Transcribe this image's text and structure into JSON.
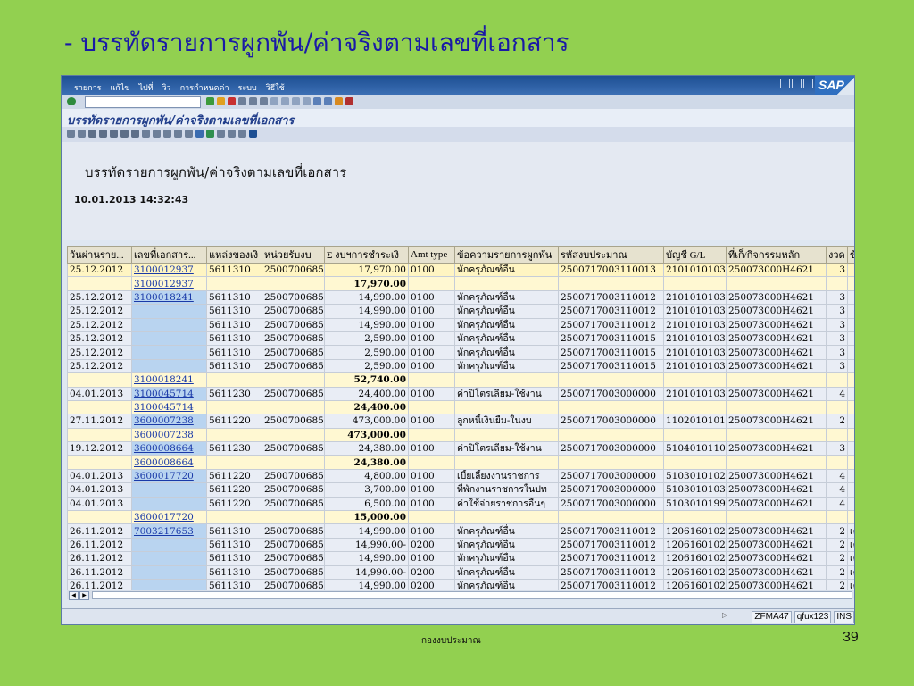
{
  "slide": {
    "title": "- บรรทัดรายการผูกพัน/ค่าจริงตามเลขที่เอกสาร",
    "footer": "กองงบประมาณ",
    "page_number": "39"
  },
  "sap": {
    "menu": [
      "รายการ",
      "แก้ไข",
      "ไปที่",
      "วิว",
      "การกำหนดค่า",
      "ระบบ",
      "วิธีใช้"
    ],
    "logo": "SAP",
    "screen_title": "บรรทัดรายการผูกพัน/ค่าจริงตามเลขที่เอกสาร",
    "report_title": "บรรทัดรายการผูกพัน/ค่าจริงตามเลขที่เอกสาร",
    "report_datetime": "10.01.2013 14:32:43",
    "columns": [
      "วันผ่านราย...",
      "เลขที่เอกสาร...",
      "แหล่งของเงิ",
      "หน่วยรับงบ",
      "Σ งบฯการชำระเงิ",
      "Amt type",
      "ข้อความรายการผูกพัน",
      "รหัสงบประมาณ",
      "บัญชี G/L",
      "ที่เก็/กิจกรรมหลัก",
      "งวด",
      "ข้อค"
    ],
    "rows": [
      {
        "type": "data",
        "first": true,
        "date": "25.12.2012",
        "doc": "3100012937",
        "fund": "5611310",
        "unit": "2500700685",
        "amt": "17,970.00",
        "amttype": "0100",
        "text": "หักครุภัณฑ์อื่น",
        "budget": "2500717003110013",
        "gl": "2101010103",
        "act": "250073000H4621",
        "per": "3",
        "x": ""
      },
      {
        "type": "sub",
        "doc": "3100012937",
        "amt": "17,970.00"
      },
      {
        "type": "data",
        "date": "25.12.2012",
        "doc": "3100018241",
        "fund": "5611310",
        "unit": "2500700685",
        "amt": "14,990.00",
        "amttype": "0100",
        "text": "หักครุภัณฑ์อื่น",
        "budget": "2500717003110012",
        "gl": "2101010103",
        "act": "250073000H4621",
        "per": "3",
        "x": ""
      },
      {
        "type": "data",
        "date": "25.12.2012",
        "doc": "",
        "fund": "5611310",
        "unit": "2500700685",
        "amt": "14,990.00",
        "amttype": "0100",
        "text": "หักครุภัณฑ์อื่น",
        "budget": "2500717003110012",
        "gl": "2101010103",
        "act": "250073000H4621",
        "per": "3",
        "x": ""
      },
      {
        "type": "data",
        "date": "25.12.2012",
        "doc": "",
        "fund": "5611310",
        "unit": "2500700685",
        "amt": "14,990.00",
        "amttype": "0100",
        "text": "หักครุภัณฑ์อื่น",
        "budget": "2500717003110012",
        "gl": "2101010103",
        "act": "250073000H4621",
        "per": "3",
        "x": ""
      },
      {
        "type": "data",
        "date": "25.12.2012",
        "doc": "",
        "fund": "5611310",
        "unit": "2500700685",
        "amt": "2,590.00",
        "amttype": "0100",
        "text": "หักครุภัณฑ์อื่น",
        "budget": "2500717003110015",
        "gl": "2101010103",
        "act": "250073000H4621",
        "per": "3",
        "x": ""
      },
      {
        "type": "data",
        "date": "25.12.2012",
        "doc": "",
        "fund": "5611310",
        "unit": "2500700685",
        "amt": "2,590.00",
        "amttype": "0100",
        "text": "หักครุภัณฑ์อื่น",
        "budget": "2500717003110015",
        "gl": "2101010103",
        "act": "250073000H4621",
        "per": "3",
        "x": ""
      },
      {
        "type": "data",
        "date": "25.12.2012",
        "doc": "",
        "fund": "5611310",
        "unit": "2500700685",
        "amt": "2,590.00",
        "amttype": "0100",
        "text": "หักครุภัณฑ์อื่น",
        "budget": "2500717003110015",
        "gl": "2101010103",
        "act": "250073000H4621",
        "per": "3",
        "x": ""
      },
      {
        "type": "sub",
        "doc": "3100018241",
        "amt": "52,740.00"
      },
      {
        "type": "data",
        "date": "04.01.2013",
        "doc": "3100045714",
        "fund": "5611230",
        "unit": "2500700685",
        "amt": "24,400.00",
        "amttype": "0100",
        "text": "ค่าปิโตรเลียม-ใช้งาน",
        "budget": "2500717003000000",
        "gl": "2101010103",
        "act": "250073000H4621",
        "per": "4",
        "x": ""
      },
      {
        "type": "sub",
        "doc": "3100045714",
        "amt": "24,400.00"
      },
      {
        "type": "data",
        "date": "27.11.2012",
        "doc": "3600007238",
        "fund": "5611220",
        "unit": "2500700685",
        "amt": "473,000.00",
        "amttype": "0100",
        "text": "ลูกหนี้เงินยืม-ในงบ",
        "budget": "2500717003000000",
        "gl": "1102010101",
        "act": "250073000H4621",
        "per": "2",
        "x": ""
      },
      {
        "type": "sub",
        "doc": "3600007238",
        "amt": "473,000.00"
      },
      {
        "type": "data",
        "date": "19.12.2012",
        "doc": "3600008664",
        "fund": "5611230",
        "unit": "2500700685",
        "amt": "24,380.00",
        "amttype": "0100",
        "text": "ค่าปิโตรเลียม-ใช้งาน",
        "budget": "2500717003000000",
        "gl": "5104010110",
        "act": "250073000H4621",
        "per": "3",
        "x": ""
      },
      {
        "type": "sub",
        "doc": "3600008664",
        "amt": "24,380.00"
      },
      {
        "type": "data",
        "date": "04.01.2013",
        "doc": "3600017720",
        "fund": "5611220",
        "unit": "2500700685",
        "amt": "4,800.00",
        "amttype": "0100",
        "text": "เบี้ยเลี้ยงงานราชการ",
        "budget": "2500717003000000",
        "gl": "5103010102",
        "act": "250073000H4621",
        "per": "4",
        "x": ""
      },
      {
        "type": "data",
        "date": "04.01.2013",
        "doc": "",
        "fund": "5611220",
        "unit": "2500700685",
        "amt": "3,700.00",
        "amttype": "0100",
        "text": "ที่พักงานราชการในปท",
        "budget": "2500717003000000",
        "gl": "5103010103",
        "act": "250073000H4621",
        "per": "4",
        "x": ""
      },
      {
        "type": "data",
        "date": "04.01.2013",
        "doc": "",
        "fund": "5611220",
        "unit": "2500700685",
        "amt": "6,500.00",
        "amttype": "0100",
        "text": "ค่าใช้จ่ายราชการอื่นๆ",
        "budget": "2500717003000000",
        "gl": "5103010199",
        "act": "250073000H4621",
        "per": "4",
        "x": ""
      },
      {
        "type": "sub",
        "doc": "3600017720",
        "amt": "15,000.00"
      },
      {
        "type": "data",
        "date": "26.11.2012",
        "doc": "7003217653",
        "fund": "5611310",
        "unit": "2500700685",
        "amt": "14,990.00",
        "amttype": "0100",
        "text": "หักครุภัณฑ์อื่น",
        "budget": "2500717003110012",
        "gl": "1206160102",
        "act": "250073000H4621",
        "per": "2",
        "x": "เครื่"
      },
      {
        "type": "data",
        "date": "26.11.2012",
        "doc": "",
        "fund": "5611310",
        "unit": "2500700685",
        "amt": "14,990.00-",
        "amttype": "0200",
        "text": "หักครุภัณฑ์อื่น",
        "budget": "2500717003110012",
        "gl": "1206160102",
        "act": "250073000H4621",
        "per": "2",
        "x": "เครื่"
      },
      {
        "type": "data",
        "date": "26.11.2012",
        "doc": "",
        "fund": "5611310",
        "unit": "2500700685",
        "amt": "14,990.00",
        "amttype": "0100",
        "text": "หักครุภัณฑ์อื่น",
        "budget": "2500717003110012",
        "gl": "1206160102",
        "act": "250073000H4621",
        "per": "2",
        "x": "เครื่"
      },
      {
        "type": "data",
        "date": "26.11.2012",
        "doc": "",
        "fund": "5611310",
        "unit": "2500700685",
        "amt": "14,990.00-",
        "amttype": "0200",
        "text": "หักครุภัณฑ์อื่น",
        "budget": "2500717003110012",
        "gl": "1206160102",
        "act": "250073000H4621",
        "per": "2",
        "x": "เครื่"
      },
      {
        "type": "data",
        "date": "26.11.2012",
        "doc": "",
        "fund": "5611310",
        "unit": "2500700685",
        "amt": "14,990.00",
        "amttype": "0200",
        "text": "หักครุภัณฑ์อื่น",
        "budget": "2500717003110012",
        "gl": "1206160102",
        "act": "250073000H4621",
        "per": "2",
        "x": "เครื่"
      }
    ],
    "status": [
      "ZFMA47",
      "qfux123",
      "INS"
    ]
  }
}
